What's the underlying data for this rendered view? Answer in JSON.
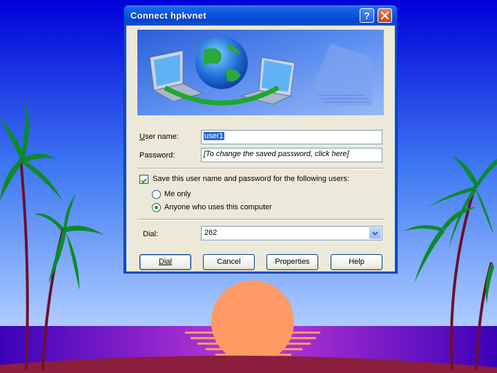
{
  "dialog": {
    "title": "Connect hpkvnet",
    "help_button": "?",
    "close_button": "✕"
  },
  "form": {
    "username_label_accel": "U",
    "username_label_rest": "ser name:",
    "username_value": "user1",
    "password_label": "Password:",
    "password_value": "[To change the saved password, click here]",
    "save_checkbox_label": "Save this user name and password for the following users:",
    "save_checked": true,
    "radio_me_only": "Me only",
    "radio_anyone": "Anyone who uses this computer",
    "selected_radio": "anyone",
    "dial_label": "Dial:",
    "dial_value": "262"
  },
  "buttons": {
    "dial": "Dial",
    "cancel": "Cancel",
    "properties": "Properties",
    "help": "Help"
  },
  "colors": {
    "titlebar": "#0a55df",
    "dialog_face": "#ece9d8",
    "sky_top": "#0000d8",
    "sun": "#ff9966",
    "ground": "#8a1e3c"
  },
  "icons": {
    "banner": "globe-network-icon",
    "dropdown": "chevron-down-icon",
    "check": "checkmark-icon"
  }
}
